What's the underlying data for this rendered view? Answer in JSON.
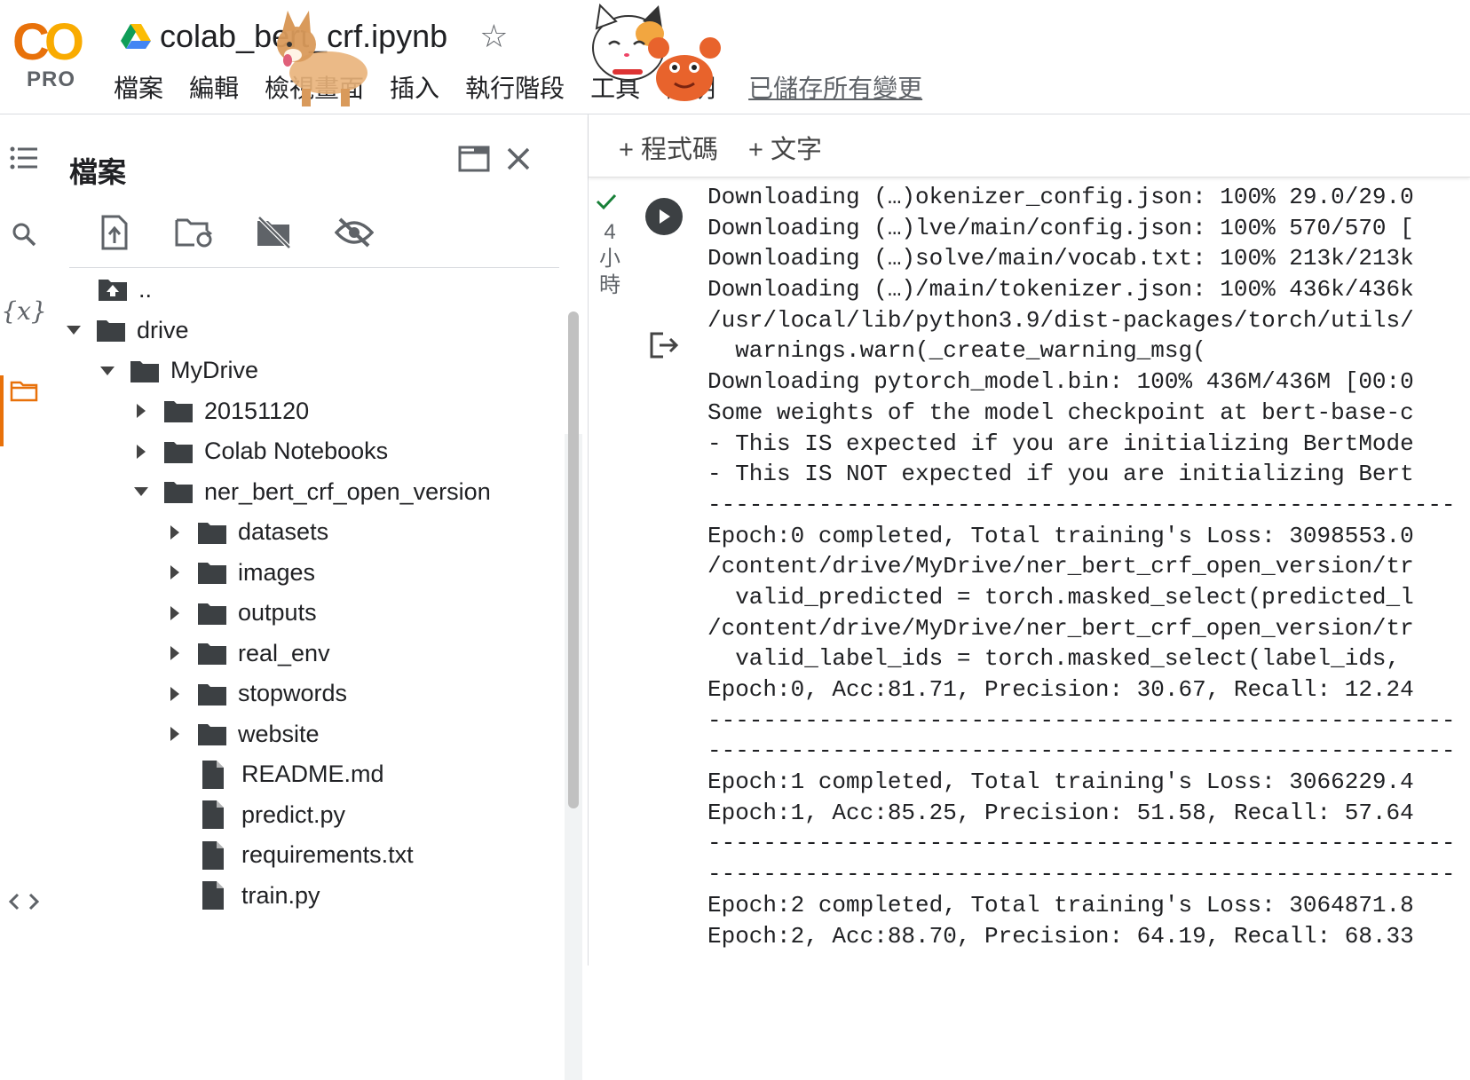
{
  "header": {
    "logo_text": "CO",
    "logo_badge": "PRO",
    "notebook_title": "colab_bert_crf.ipynb",
    "menu": [
      "檔案",
      "編輯",
      "檢視畫面",
      "插入",
      "執行階段",
      "工具",
      "說明"
    ],
    "save_status": "已儲存所有變更"
  },
  "rail": {
    "variables_label": "{x}"
  },
  "file_panel": {
    "title": "檔案",
    "parent_label": "..",
    "tree": [
      {
        "label": "drive",
        "type": "folder",
        "level": 0,
        "expanded": true
      },
      {
        "label": "MyDrive",
        "type": "folder",
        "level": 1,
        "expanded": true
      },
      {
        "label": "20151120",
        "type": "folder",
        "level": 2,
        "expanded": false
      },
      {
        "label": "Colab Notebooks",
        "type": "folder",
        "level": 2,
        "expanded": false
      },
      {
        "label": "ner_bert_crf_open_version",
        "type": "folder",
        "level": 2,
        "expanded": true
      },
      {
        "label": "datasets",
        "type": "folder",
        "level": 3,
        "expanded": false
      },
      {
        "label": "images",
        "type": "folder",
        "level": 3,
        "expanded": false
      },
      {
        "label": "outputs",
        "type": "folder",
        "level": 3,
        "expanded": false
      },
      {
        "label": "real_env",
        "type": "folder",
        "level": 3,
        "expanded": false
      },
      {
        "label": "stopwords",
        "type": "folder",
        "level": 3,
        "expanded": false
      },
      {
        "label": "website",
        "type": "folder",
        "level": 3,
        "expanded": false
      },
      {
        "label": "README.md",
        "type": "file",
        "level": 3
      },
      {
        "label": "predict.py",
        "type": "file",
        "level": 3
      },
      {
        "label": "requirements.txt",
        "type": "file",
        "level": 3
      },
      {
        "label": "train.py",
        "type": "file",
        "level": 3
      }
    ]
  },
  "editor": {
    "add_code": "+ 程式碼",
    "add_text": "+ 文字",
    "cell_age": [
      "4",
      "小",
      "時"
    ],
    "output_lines": [
      "Downloading (…)okenizer_config.json: 100% 29.0/29.0",
      "Downloading (…)lve/main/config.json: 100% 570/570 [",
      "Downloading (…)solve/main/vocab.txt: 100% 213k/213k",
      "Downloading (…)/main/tokenizer.json: 100% 436k/436k",
      "/usr/local/lib/python3.9/dist-packages/torch/utils/",
      "  warnings.warn(_create_warning_msg(",
      "Downloading pytorch_model.bin: 100% 436M/436M [00:0",
      "Some weights of the model checkpoint at bert-base-c",
      "- This IS expected if you are initializing BertMode",
      "- This IS NOT expected if you are initializing Bert",
      "------------------------------------------------------",
      "Epoch:0 completed, Total training's Loss: 3098553.0",
      "/content/drive/MyDrive/ner_bert_crf_open_version/tr",
      "  valid_predicted = torch.masked_select(predicted_l",
      "/content/drive/MyDrive/ner_bert_crf_open_version/tr",
      "  valid_label_ids = torch.masked_select(label_ids, ",
      "Epoch:0, Acc:81.71, Precision: 30.67, Recall: 12.24",
      "------------------------------------------------------",
      "------------------------------------------------------",
      "Epoch:1 completed, Total training's Loss: 3066229.4",
      "Epoch:1, Acc:85.25, Precision: 51.58, Recall: 57.64",
      "------------------------------------------------------",
      "------------------------------------------------------",
      "Epoch:2 completed, Total training's Loss: 3064871.8",
      "Epoch:2, Acc:88.70, Precision: 64.19, Recall: 68.33"
    ]
  },
  "colors": {
    "accent": "#e8710a",
    "logo_yellow": "#f9ab00",
    "success": "#188038"
  }
}
